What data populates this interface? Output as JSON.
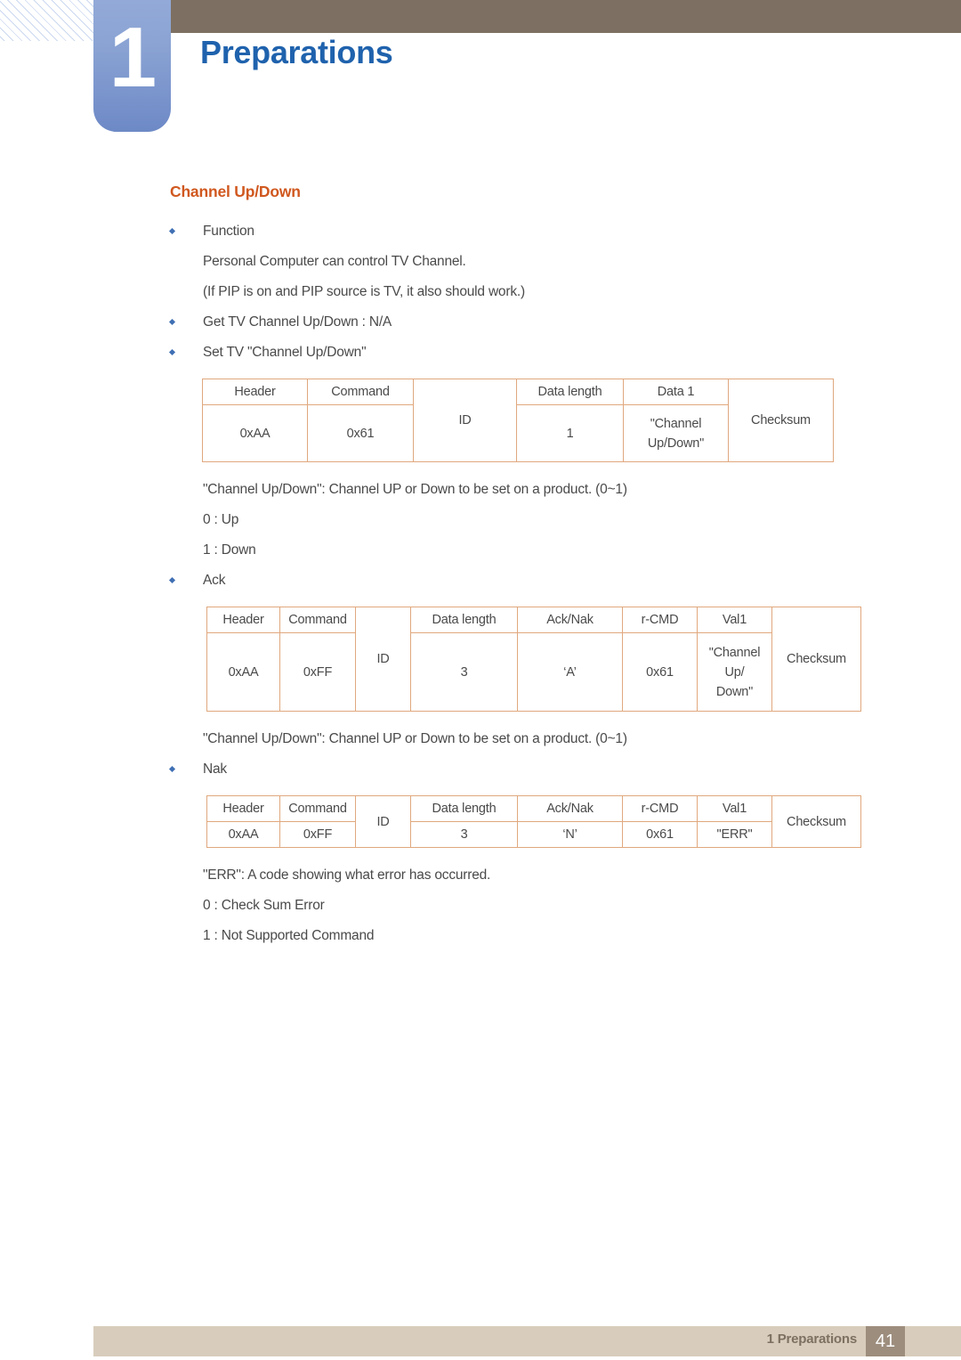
{
  "header": {
    "chapter_number": "1",
    "chapter_title": "Preparations",
    "bar_color": "#7d7062",
    "number_box_color": "#7b95cd",
    "title_color": "#1f62ad"
  },
  "section": {
    "title": "Channel Up/Down",
    "title_color": "#d0581f"
  },
  "body": {
    "function_label": "Function",
    "function_line1": "Personal Computer can control TV Channel.",
    "function_line2": "(If PIP is on and PIP source is TV, it also should work.)",
    "get_line": "Get TV Channel Up/Down :  N/A",
    "set_line": "Set TV \"Channel Up/Down\"",
    "note_set": "\"Channel Up/Down\": Channel UP or Down to be set on a product. (0~1)",
    "note_set_0": "0 : Up",
    "note_set_1": "1 : Down",
    "ack_label": "Ack",
    "note_ack": "\"Channel Up/Down\": Channel UP or Down to be set on a product. (0~1)",
    "nak_label": "Nak",
    "note_err": "\"ERR\": A code showing what error has occurred.",
    "note_err_0": "0 : Check Sum Error",
    "note_err_1": "1 : Not Supported Command"
  },
  "tables": {
    "set": {
      "headers": [
        "Header",
        "Command",
        "ID",
        "Data length",
        "Data 1",
        "Checksum"
      ],
      "values": [
        "0xAA",
        "0x61",
        "ID",
        "1",
        "\"Channel\nUp/Down\"",
        "Checksum"
      ],
      "header_row": [
        "Header",
        "Command",
        "",
        "Data length",
        "Data 1",
        ""
      ],
      "value_row": [
        "0xAA",
        "0x61",
        "ID",
        "1",
        "\"Channel Up/Down\"",
        "Checksum"
      ],
      "data1_line1": "\"Channel",
      "data1_line2": "Up/Down\""
    },
    "ack": {
      "header_row": [
        "Header",
        "Command",
        "",
        "Data length",
        "Ack/Nak",
        "r-CMD",
        "Val1",
        ""
      ],
      "value_row": [
        "0xAA",
        "0xFF",
        "ID",
        "3",
        "‘A’",
        "0x61",
        "\"Channel Up/ Down\"",
        "Checksum"
      ],
      "h_header": "Header",
      "h_command": "Command",
      "h_id": "ID",
      "h_datalength": "Data length",
      "h_acknak": "Ack/Nak",
      "h_rcmd": "r-CMD",
      "h_val1": "Val1",
      "h_checksum": "Checksum",
      "v_header": "0xAA",
      "v_command": "0xFF",
      "v_datalength": "3",
      "v_acknak": "‘A’",
      "v_rcmd": "0x61",
      "v_val1_line1": "\"Channel",
      "v_val1_line2": "Up/",
      "v_val1_line3": "Down\""
    },
    "nak": {
      "h_header": "Header",
      "h_command": "Command",
      "h_id": "ID",
      "h_datalength": "Data length",
      "h_acknak": "Ack/Nak",
      "h_rcmd": "r-CMD",
      "h_val1": "Val1",
      "h_checksum": "Checksum",
      "v_header": "0xAA",
      "v_command": "0xFF",
      "v_datalength": "3",
      "v_acknak": "‘N’",
      "v_rcmd": "0x61",
      "v_val1": "\"ERR\""
    }
  },
  "footer": {
    "label": "1 Preparations",
    "page_number": "41",
    "bar_color": "#d8cdbc",
    "page_box_color": "#9d8d7d"
  }
}
